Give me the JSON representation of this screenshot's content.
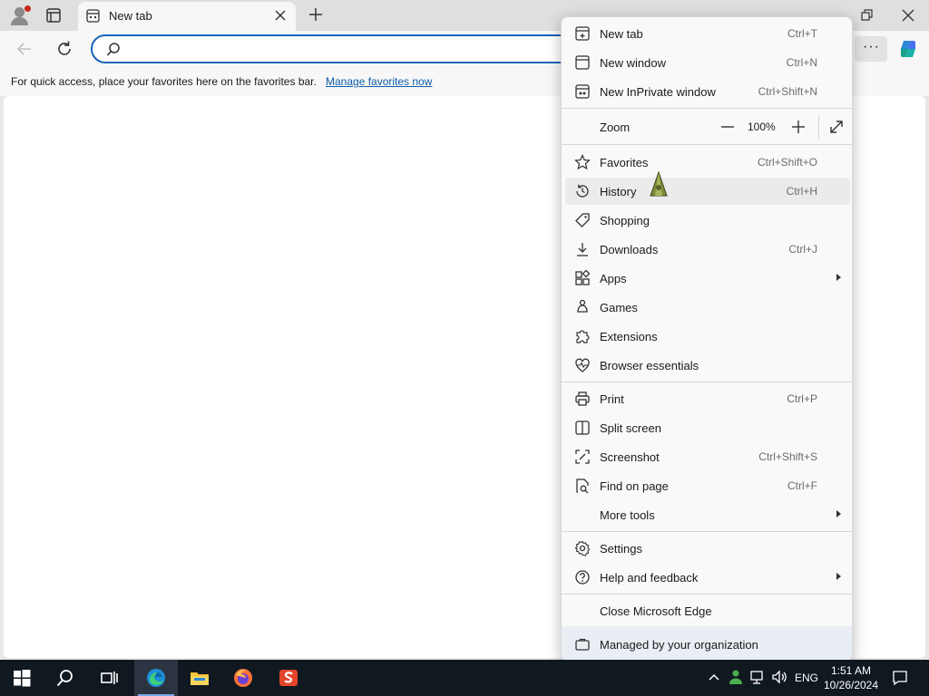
{
  "tab": {
    "title": "New tab"
  },
  "address": {
    "placeholder": ""
  },
  "favorites_bar": {
    "message": "For quick access, place your favorites here on the favorites bar.",
    "link": "Manage favorites now"
  },
  "menu": {
    "new_tab": {
      "label": "New tab",
      "shortcut": "Ctrl+T"
    },
    "new_window": {
      "label": "New window",
      "shortcut": "Ctrl+N"
    },
    "new_inprivate": {
      "label": "New InPrivate window",
      "shortcut": "Ctrl+Shift+N"
    },
    "zoom": {
      "label": "Zoom",
      "value": "100%"
    },
    "favorites": {
      "label": "Favorites",
      "shortcut": "Ctrl+Shift+O"
    },
    "history": {
      "label": "History",
      "shortcut": "Ctrl+H"
    },
    "shopping": {
      "label": "Shopping"
    },
    "downloads": {
      "label": "Downloads",
      "shortcut": "Ctrl+J"
    },
    "apps": {
      "label": "Apps"
    },
    "games": {
      "label": "Games"
    },
    "extensions": {
      "label": "Extensions"
    },
    "browser_essentials": {
      "label": "Browser essentials"
    },
    "print": {
      "label": "Print",
      "shortcut": "Ctrl+P"
    },
    "split_screen": {
      "label": "Split screen"
    },
    "screenshot": {
      "label": "Screenshot",
      "shortcut": "Ctrl+Shift+S"
    },
    "find_on_page": {
      "label": "Find on page",
      "shortcut": "Ctrl+F"
    },
    "more_tools": {
      "label": "More tools"
    },
    "settings": {
      "label": "Settings"
    },
    "help_feedback": {
      "label": "Help and feedback"
    },
    "close_edge": {
      "label": "Close Microsoft Edge"
    },
    "managed": {
      "label": "Managed by your organization"
    }
  },
  "taskbar": {
    "language": "ENG",
    "time": "1:51 AM",
    "date": "10/26/2024"
  },
  "colors": {
    "accent": "#1a63b8",
    "taskbar": "#101820",
    "link": "#0f5ca8"
  }
}
